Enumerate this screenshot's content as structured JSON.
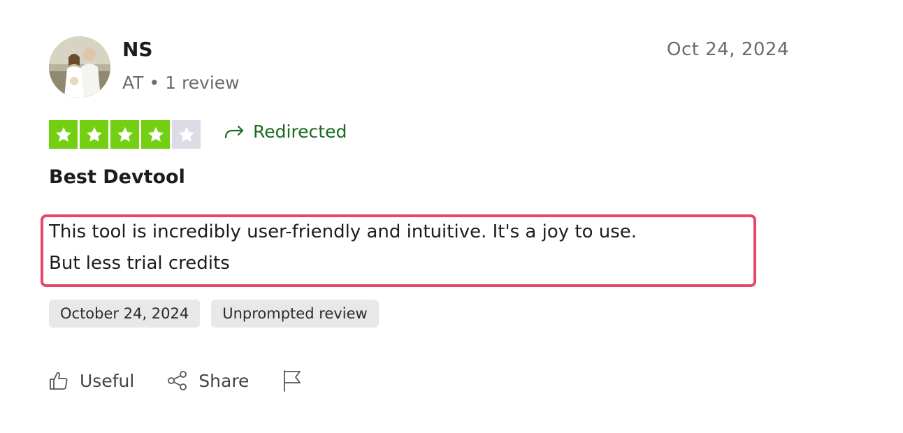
{
  "reviewer": {
    "name": "NS",
    "country": "AT",
    "separator": "•",
    "review_count": "1 review",
    "avatar_icon": "reviewer-avatar-photo"
  },
  "review": {
    "date": "Oct 24, 2024",
    "rating": 4,
    "rating_max": 5,
    "star_color": "#73cf11",
    "star_empty_color": "#dcdce6",
    "redirected_label": "Redirected",
    "title": "Best Devtool",
    "body_line1": "This tool is incredibly user-friendly and intuitive. It's a joy to use.",
    "body_line2": "But less trial credits",
    "highlight_color": "#e8456b"
  },
  "tags": {
    "date_of_experience": "October 24, 2024",
    "review_type": "Unprompted review"
  },
  "actions": {
    "useful_label": "Useful",
    "share_label": "Share",
    "useful_icon": "thumbs-up-icon",
    "share_icon": "share-icon",
    "flag_icon": "flag-icon"
  }
}
